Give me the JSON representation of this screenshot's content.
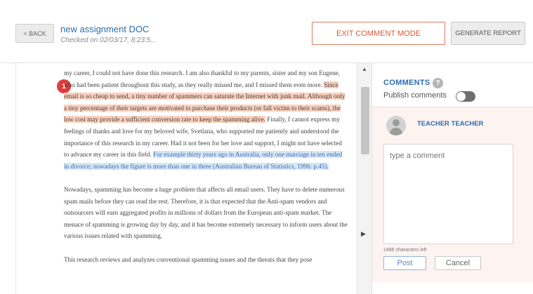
{
  "header": {
    "back_label": "< BACK",
    "doc_title": "new assignment DOC",
    "checked_text": "Checked on 02/03/17, 8:23:5...",
    "exit_label": "EXIT COMMENT MODE",
    "report_label": "GENERATE REPORT"
  },
  "document": {
    "marker": "1",
    "p1_a": "my career, I could not have done this research. I am also thankful to my parents, sister and my son Eugene, who had been patient throughout this study, as they really missed me, and I missed them even more. ",
    "p1_highlight_red": "Since email is so cheap to send, a tiny number of spammers can saturate the Internet with junk mail. Although only a tiny percentage of their targets are motivated to purchase their products (or fall victim to their scams), the low cost may provide a sufficient conversion rate to keep the spamming alive.",
    "p1_b": " Finally, I cannot express my feelings of thanks and love for my beloved wife, Svetlana, who supported me patiently and understood the importance of this research in my career. Had it not been for her love and support, I might not have selected to advance my career in this field. ",
    "p1_highlight_blue": "For example thirty years ago in Australia, only one marriage in ten ended in divorce; nowadays the figure is more than one in three (Australian Bureau of Statistics, 1996: p.45).",
    "p2": "Nowadays, spamming has become a huge problem that affects all email users. They have to delete numerous spam mails before they can read the rest. Therefore, it is that expected that the Anti-spam vendors and outsourcers will earn aggregated profits in millions of dollars from the European anti-spam market. The menace of spamming is growing day by day, and it has become extremely necessary to inform users about the various issues related with spamming.",
    "p3": "This research reviews and analyzes conventional spamming issues and the threats that they pose"
  },
  "scroll": {
    "up_icon": "▲",
    "toggle_icon": "▶"
  },
  "comments": {
    "title": "COMMENTS",
    "help_icon": "?",
    "publish_label": "Publish comments",
    "publish_enabled": false,
    "author": "TEACHER TEACHER",
    "placeholder": "type a comment",
    "chars_left": "1486 characters left",
    "post_label": "Post",
    "cancel_label": "Cancel"
  }
}
